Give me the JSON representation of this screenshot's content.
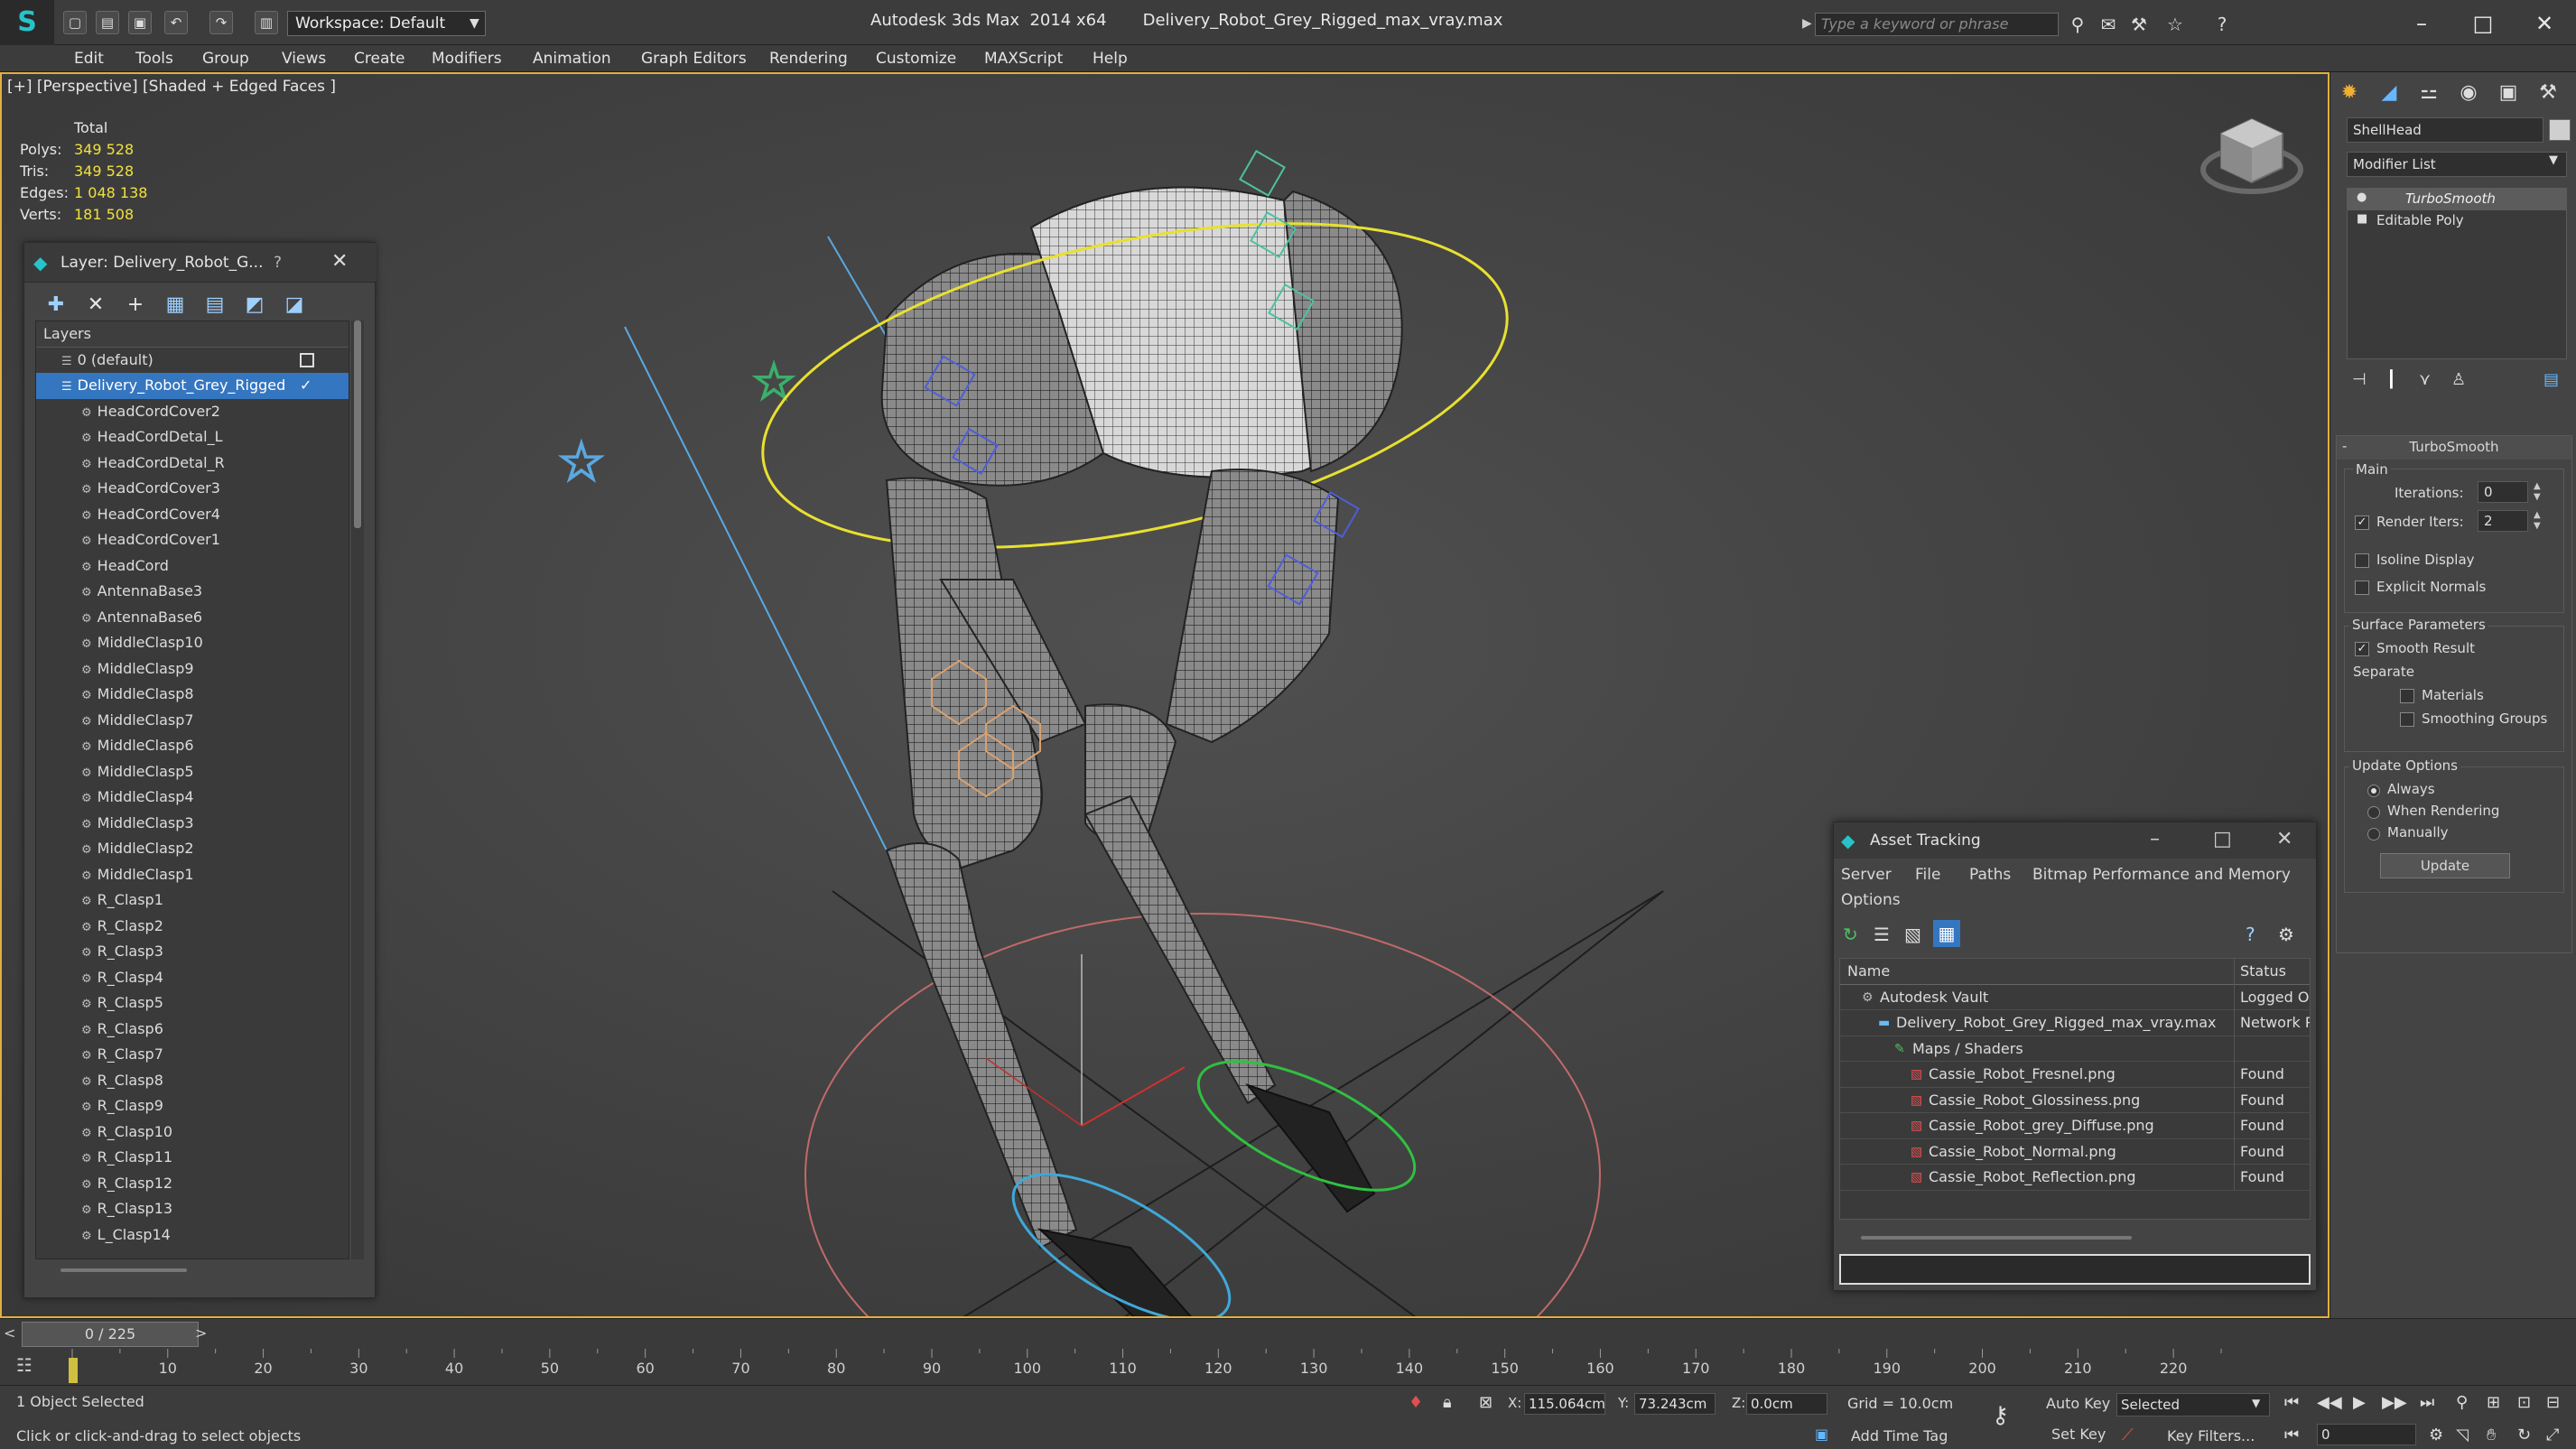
{
  "titlebar": {
    "workspace_label": "Workspace: Default",
    "window_title": "Autodesk 3ds Max  2014 x64       Delivery_Robot_Grey_Rigged_max_vray.max",
    "search_placeholder": "Type a keyword or phrase"
  },
  "menu": [
    "Edit",
    "Tools",
    "Group",
    "Views",
    "Create",
    "Modifiers",
    "Animation",
    "Graph Editors",
    "Rendering",
    "Customize",
    "MAXScript",
    "Help"
  ],
  "viewport": {
    "label": "[+] [Perspective] [Shaded + Edged Faces ]",
    "stats": {
      "header": "Total",
      "rows": [
        {
          "label": "Polys:",
          "value": "349 528"
        },
        {
          "label": "Tris:",
          "value": "349 528"
        },
        {
          "label": "Edges:",
          "value": "1 048 138"
        },
        {
          "label": "Verts:",
          "value": "181 508"
        }
      ]
    }
  },
  "layer_panel": {
    "title": "Layer: Delivery_Robot_G...",
    "help": "?",
    "column_header": "Layers",
    "default_layer": "0 (default)",
    "active_layer": "Delivery_Robot_Grey_Rigged",
    "items": [
      "HeadCordCover2",
      "HeadCordDetal_L",
      "HeadCordDetal_R",
      "HeadCordCover3",
      "HeadCordCover4",
      "HeadCordCover1",
      "HeadCord",
      "AntennaBase3",
      "AntennaBase6",
      "MiddleClasp10",
      "MiddleClasp9",
      "MiddleClasp8",
      "MiddleClasp7",
      "MiddleClasp6",
      "MiddleClasp5",
      "MiddleClasp4",
      "MiddleClasp3",
      "MiddleClasp2",
      "MiddleClasp1",
      "R_Clasp1",
      "R_Clasp2",
      "R_Clasp3",
      "R_Clasp4",
      "R_Clasp5",
      "R_Clasp6",
      "R_Clasp7",
      "R_Clasp8",
      "R_Clasp9",
      "R_Clasp10",
      "R_Clasp11",
      "R_Clasp12",
      "R_Clasp13",
      "L_Clasp14"
    ]
  },
  "command_panel": {
    "object_name": "ShellHead",
    "modifier_list": "Modifier List",
    "stack": [
      "TurboSmooth",
      "Editable Poly"
    ],
    "rollout_title": "TurboSmooth",
    "main_group": "Main",
    "iterations_label": "Iterations:",
    "iterations_value": "0",
    "render_iters_label": "Render Iters:",
    "render_iters_value": "2",
    "isoline_label": "Isoline Display",
    "explicit_normals_label": "Explicit Normals",
    "surface_params_label": "Surface Parameters",
    "smooth_result_label": "Smooth Result",
    "separate_label": "Separate",
    "materials_label": "Materials",
    "smoothing_groups_label": "Smoothing Groups",
    "update_options_label": "Update Options",
    "always_label": "Always",
    "when_rendering_label": "When Rendering",
    "manually_label": "Manually",
    "update_button": "Update"
  },
  "asset_tracking": {
    "title": "Asset Tracking",
    "menu": [
      "Server",
      "File",
      "Paths",
      "Bitmap Performance and Memory"
    ],
    "options_label": "Options",
    "col_name": "Name",
    "col_status": "Status",
    "rows": [
      {
        "name": "Autodesk Vault",
        "status": "Logged O"
      },
      {
        "name": "Delivery_Robot_Grey_Rigged_max_vray.max",
        "status": "Network P"
      },
      {
        "name": "Maps / Shaders",
        "status": ""
      },
      {
        "name": "Cassie_Robot_Fresnel.png",
        "status": "Found"
      },
      {
        "name": "Cassie_Robot_Glossiness.png",
        "status": "Found"
      },
      {
        "name": "Cassie_Robot_grey_Diffuse.png",
        "status": "Found"
      },
      {
        "name": "Cassie_Robot_Normal.png",
        "status": "Found"
      },
      {
        "name": "Cassie_Robot_Reflection.png",
        "status": "Found"
      }
    ]
  },
  "timeline": {
    "frame_counter": "0 / 225",
    "ticks": [
      "10",
      "20",
      "30",
      "40",
      "50",
      "60",
      "70",
      "80",
      "90",
      "100",
      "110",
      "120",
      "130",
      "140",
      "150",
      "160",
      "170",
      "180",
      "190",
      "200",
      "210",
      "220"
    ]
  },
  "status": {
    "selection": "1 Object Selected",
    "prompt": "Click or click-and-drag to select objects",
    "x_label": "X:",
    "x_value": "115.064cm",
    "y_label": "Y:",
    "y_value": "73.243cm",
    "z_label": "Z:",
    "z_value": "0.0cm",
    "grid": "Grid = 10.0cm",
    "add_time_tag": "Add Time Tag",
    "auto_key": "Auto Key",
    "set_key": "Set Key",
    "selected_dropdown": "Selected",
    "key_filters": "Key Filters...",
    "frame_value": "0"
  }
}
